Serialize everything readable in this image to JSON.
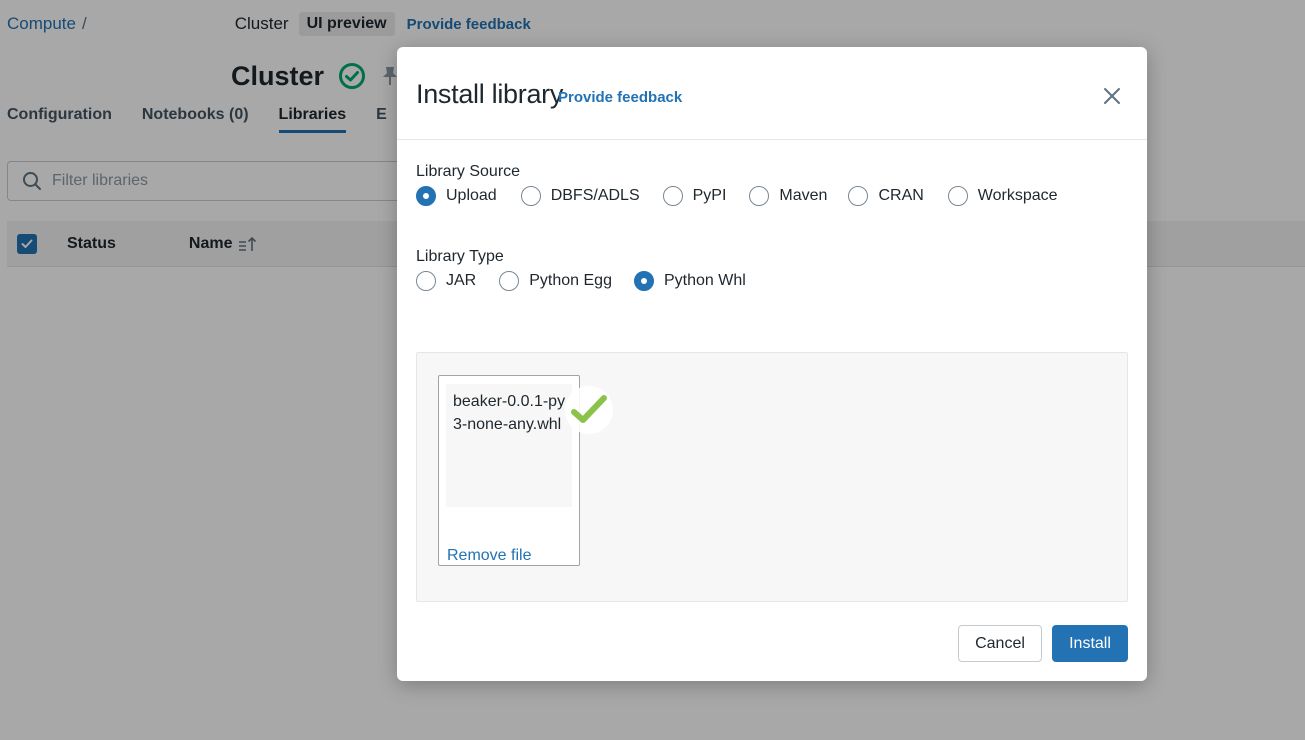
{
  "breadcrumb": {
    "root": "Compute",
    "separator": "/",
    "cluster_suffix": "Cluster",
    "preview_badge": "UI preview",
    "feedback": "Provide feedback"
  },
  "page": {
    "title": "Cluster",
    "tabs": [
      {
        "label": "Configuration"
      },
      {
        "label": "Notebooks (0)"
      },
      {
        "label": "Libraries"
      },
      {
        "label": "E"
      }
    ],
    "filter_placeholder": "Filter libraries",
    "table_headers": {
      "status": "Status",
      "name": "Name"
    }
  },
  "modal": {
    "title": "Install library",
    "feedback": "Provide feedback",
    "source_label": "Library Source",
    "sources": [
      {
        "label": "Upload",
        "checked": true
      },
      {
        "label": "DBFS/ADLS",
        "checked": false
      },
      {
        "label": "PyPI",
        "checked": false
      },
      {
        "label": "Maven",
        "checked": false
      },
      {
        "label": "CRAN",
        "checked": false
      },
      {
        "label": "Workspace",
        "checked": false
      }
    ],
    "type_label": "Library Type",
    "types": [
      {
        "label": "JAR",
        "checked": false
      },
      {
        "label": "Python Egg",
        "checked": false
      },
      {
        "label": "Python Whl",
        "checked": true
      }
    ],
    "file": {
      "name": "beaker-0.0.1-py3-none-any.whl",
      "remove": "Remove file"
    },
    "cancel": "Cancel",
    "install": "Install"
  },
  "colors": {
    "accent": "#2272b4",
    "success": "#00a972",
    "upload_check": "#8bc34a"
  }
}
